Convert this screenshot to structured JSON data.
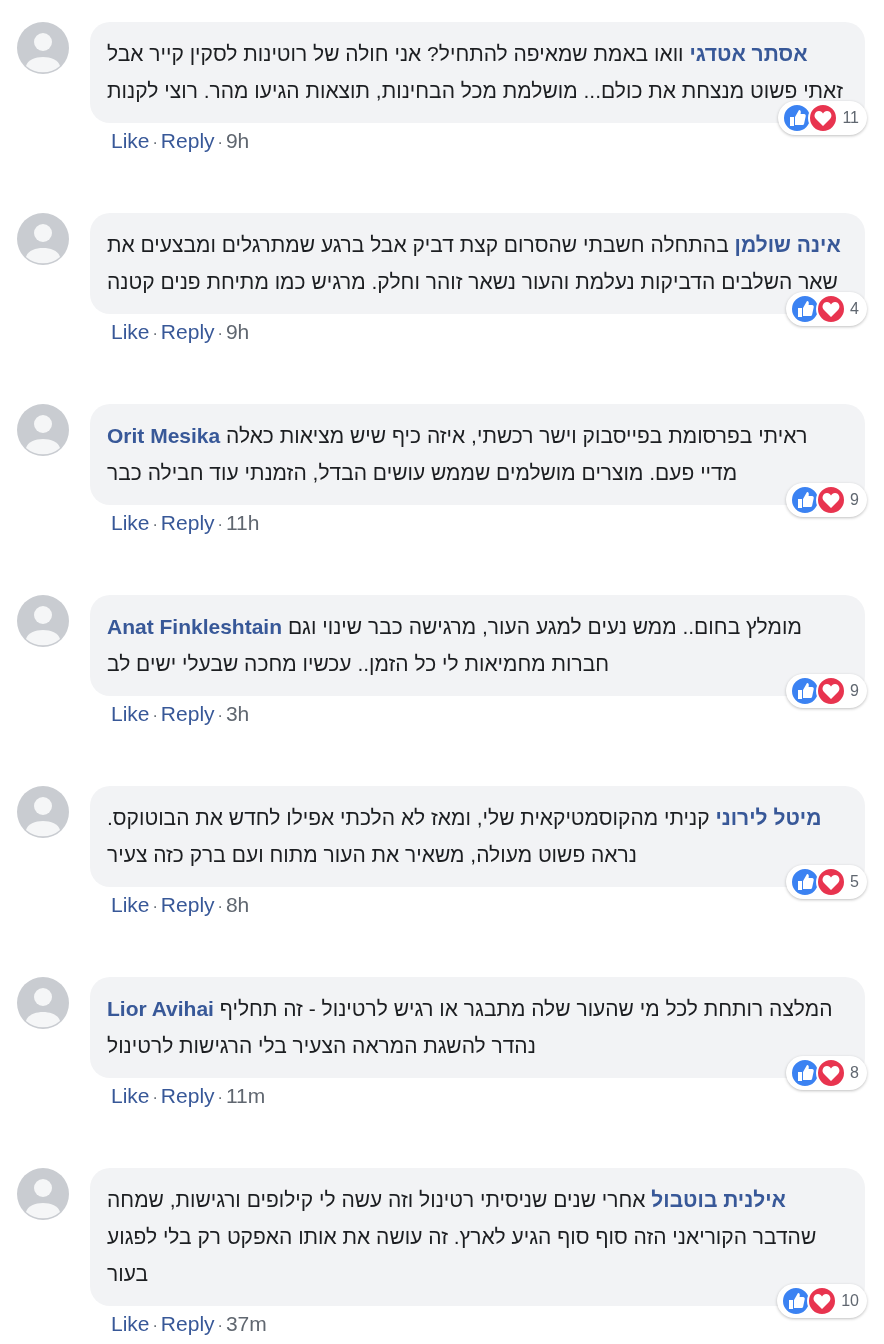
{
  "comments": [
    {
      "author": "אסתר אטדגי",
      "text": "וואו באמת שמאיפה להתחיל? אני חולה של רוטינות לסקין קייר אבל זאתי פשוט מנצחת את כולם... מושלמת מכל הבחינות, תוצאות הגיעו מהר. רוצי לקנות",
      "reaction_count": "11",
      "like": "Like",
      "reply": "Reply",
      "dot1": "·",
      "dot2": "·",
      "time": "9h"
    },
    {
      "author": "אינה שולמן",
      "text": "בהתחלה חשבתי שהסרום קצת דביק אבל ברגע שמתרגלים ומבצעים את שאר השלבים הדביקות נעלמת והעור נשאר זוהר וחלק. מרגיש כמו מתיחת פנים קטנה",
      "reaction_count": "4",
      "like": "Like",
      "reply": "Reply",
      "dot1": "·",
      "dot2": "·",
      "time": "9h"
    },
    {
      "author": "Orit Mesika",
      "text": "ראיתי בפרסומת בפייסבוק וישר רכשתי, איזה כיף שיש מציאות כאלה מדיי פעם. מוצרים מושלמים שממש עושים הבדל, הזמנתי עוד חבילה כבר",
      "reaction_count": "9",
      "like": "Like",
      "reply": "Reply",
      "dot1": "·",
      "dot2": "·",
      "time": "11h"
    },
    {
      "author": "Anat Finkleshtain",
      "text": "מומלץ בחום.. ממש נעים למגע העור, מרגישה כבר שינוי וגם חברות מחמיאות לי כל הזמן.. עכשיו מחכה שבעלי ישים לב",
      "reaction_count": "9",
      "like": "Like",
      "reply": "Reply",
      "dot1": "·",
      "dot2": "·",
      "time": "3h"
    },
    {
      "author": "מיטל לירוני",
      "text": "קניתי מהקוסמטיקאית שלי, ומאז לא הלכתי אפילו לחדש את הבוטוקס. נראה פשוט מעולה, משאיר את העור מתוח ועם ברק כזה צעיר",
      "reaction_count": "5",
      "like": "Like",
      "reply": "Reply",
      "dot1": "·",
      "dot2": "·",
      "time": "8h"
    },
    {
      "author": "Lior Avihai",
      "text": "המלצה רותחת לכל מי שהעור שלה מתבגר או רגיש לרטינול - זה תחליף נהדר להשגת המראה הצעיר בלי הרגישות לרטינול",
      "reaction_count": "8",
      "like": "Like",
      "reply": "Reply",
      "dot1": "·",
      "dot2": "·",
      "time": "11m"
    },
    {
      "author": "אילנית בוטבול",
      "text": "אחרי שנים שניסיתי רטינול וזה עשה לי קילופים ורגישות, שמחה שהדבר הקוריאני הזה סוף סוף הגיע לארץ. זה עושה את אותו האפקט רק בלי לפגוע בעור",
      "reaction_count": "10",
      "like": "Like",
      "reply": "Reply",
      "dot1": "·",
      "dot2": "·",
      "time": "37m"
    }
  ]
}
